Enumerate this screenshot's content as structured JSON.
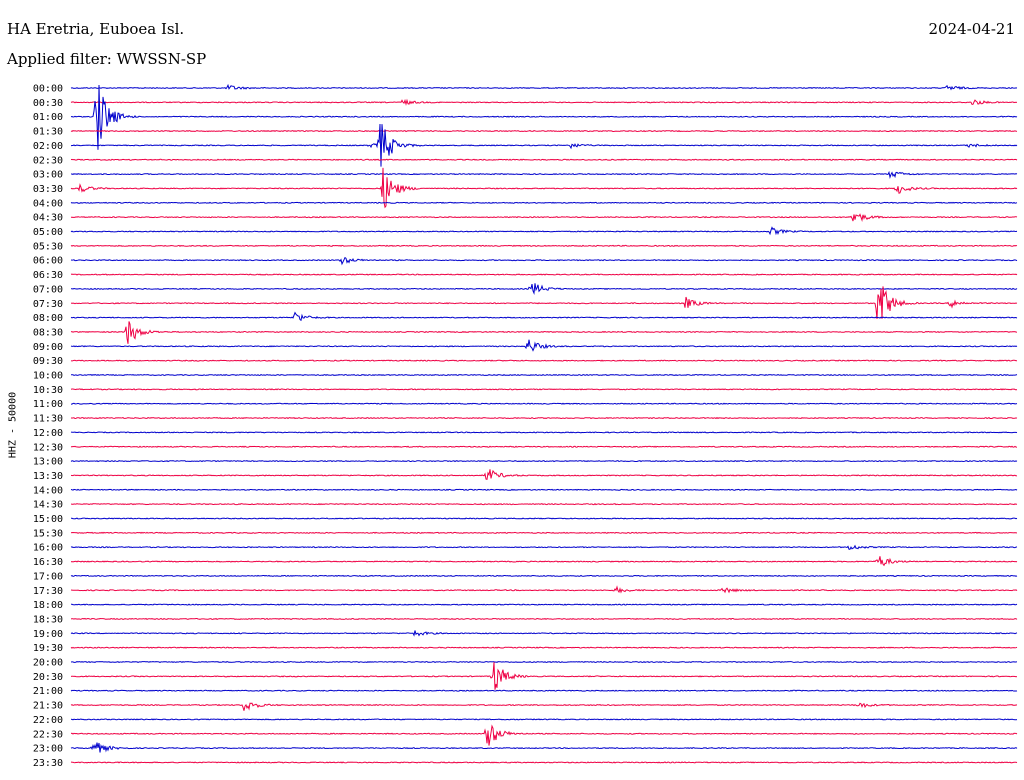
{
  "header": {
    "station": "HA Eretria, Euboea Isl.",
    "date": "2024-04-21",
    "filter": "Applied filter: WWSSN-SP"
  },
  "chart_data": {
    "type": "line",
    "title": "HA Eretria, Euboea Isl.",
    "subtitle": "Applied filter: WWSSN-SP",
    "ylabel": "HHZ - 50000",
    "row_labels": [
      "00:00",
      "00:30",
      "01:00",
      "01:30",
      "02:00",
      "02:30",
      "03:00",
      "03:30",
      "04:00",
      "04:30",
      "05:00",
      "05:30",
      "06:00",
      "06:30",
      "07:00",
      "07:30",
      "08:00",
      "08:30",
      "09:00",
      "09:30",
      "10:00",
      "10:30",
      "11:00",
      "11:30",
      "12:00",
      "12:30",
      "13:00",
      "13:30",
      "14:00",
      "14:30",
      "15:00",
      "15:30",
      "16:00",
      "16:30",
      "17:00",
      "17:30",
      "18:00",
      "18:30",
      "19:00",
      "19:30",
      "20:00",
      "20:30",
      "21:00",
      "21:30",
      "22:00",
      "22:30",
      "23:00",
      "23:30"
    ],
    "series_colors": [
      "#0000cc",
      "#ee0044"
    ],
    "trace_window_minutes": 30,
    "events": [
      {
        "row": 0,
        "minute": 5.0,
        "amp": 3
      },
      {
        "row": 0,
        "minute": 27.8,
        "amp": 3
      },
      {
        "row": 1,
        "minute": 10.5,
        "amp": 3
      },
      {
        "row": 1,
        "minute": 28.6,
        "amp": 3
      },
      {
        "row": 2,
        "minute": 0.8,
        "amp": 45
      },
      {
        "row": 4,
        "minute": 9.5,
        "amp": 2
      },
      {
        "row": 4,
        "minute": 15.8,
        "amp": 3
      },
      {
        "row": 4,
        "minute": 28.5,
        "amp": 2
      },
      {
        "row": 4,
        "minute": 9.8,
        "amp": 28
      },
      {
        "row": 7,
        "minute": 9.9,
        "amp": 24
      },
      {
        "row": 7,
        "minute": 0.3,
        "amp": 4
      },
      {
        "row": 7,
        "minute": 26.2,
        "amp": 6
      },
      {
        "row": 6,
        "minute": 26.0,
        "amp": 4
      },
      {
        "row": 9,
        "minute": 24.8,
        "amp": 8
      },
      {
        "row": 10,
        "minute": 22.2,
        "amp": 4
      },
      {
        "row": 12,
        "minute": 8.6,
        "amp": 4
      },
      {
        "row": 14,
        "minute": 14.6,
        "amp": 8
      },
      {
        "row": 15,
        "minute": 19.5,
        "amp": 6
      },
      {
        "row": 15,
        "minute": 25.6,
        "amp": 30
      },
      {
        "row": 15,
        "minute": 27.9,
        "amp": 4
      },
      {
        "row": 16,
        "minute": 7.1,
        "amp": 6
      },
      {
        "row": 17,
        "minute": 1.8,
        "amp": 14
      },
      {
        "row": 18,
        "minute": 14.5,
        "amp": 8
      },
      {
        "row": 27,
        "minute": 13.2,
        "amp": 8
      },
      {
        "row": 32,
        "minute": 24.7,
        "amp": 3
      },
      {
        "row": 33,
        "minute": 25.6,
        "amp": 7
      },
      {
        "row": 35,
        "minute": 17.3,
        "amp": 3
      },
      {
        "row": 35,
        "minute": 20.7,
        "amp": 3
      },
      {
        "row": 38,
        "minute": 10.9,
        "amp": 3
      },
      {
        "row": 41,
        "minute": 13.4,
        "amp": 18
      },
      {
        "row": 43,
        "minute": 5.5,
        "amp": 7
      },
      {
        "row": 43,
        "minute": 25.0,
        "amp": 3
      },
      {
        "row": 45,
        "minute": 13.2,
        "amp": 16
      },
      {
        "row": 46,
        "minute": 0.7,
        "amp": 9
      }
    ]
  }
}
